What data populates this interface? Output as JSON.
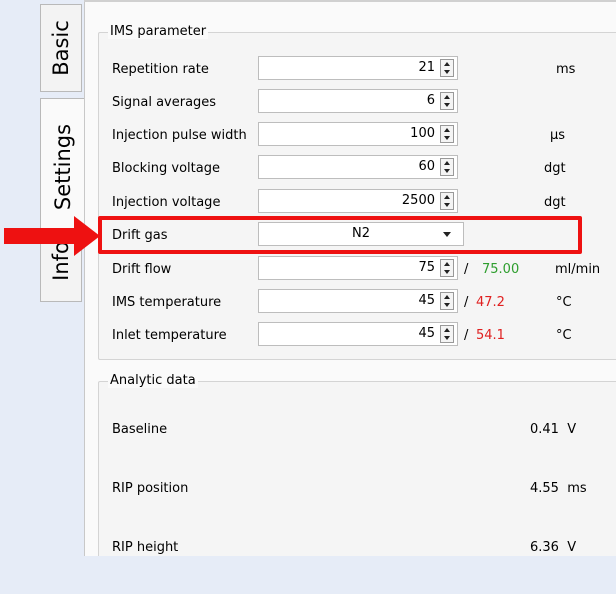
{
  "tabs": [
    {
      "label": "Basic"
    },
    {
      "label": "Settings"
    },
    {
      "label": "Info"
    }
  ],
  "ims": {
    "title": "IMS parameter",
    "rows": [
      {
        "label": "Repetition rate",
        "value": "21",
        "unit": "ms"
      },
      {
        "label": "Signal averages",
        "value": "6",
        "unit": ""
      },
      {
        "label": "Injection pulse width",
        "value": "100",
        "unit": "μs"
      },
      {
        "label": "Blocking voltage",
        "value": "60",
        "unit": "dgt"
      },
      {
        "label": "Injection voltage",
        "value": "2500",
        "unit": "dgt"
      },
      {
        "label": "Drift gas",
        "value": "N2",
        "unit": ""
      },
      {
        "label": "Drift flow",
        "value": "75",
        "separator": "/",
        "measured": "75.00",
        "unit": "ml/min"
      },
      {
        "label": "IMS temperature",
        "value": "45",
        "separator": "/",
        "measured": "47.2",
        "unit": "°C"
      },
      {
        "label": "Inlet temperature",
        "value": "45",
        "separator": "/",
        "measured": "54.1",
        "unit": "°C"
      }
    ]
  },
  "analytic": {
    "title": "Analytic data",
    "rows": [
      {
        "label": "Baseline",
        "value": "0.41  V"
      },
      {
        "label": "RIP position",
        "value": "4.55  ms"
      },
      {
        "label": "RIP height",
        "value": "6.36  V"
      }
    ]
  },
  "colors": {
    "ok": "#2e9e2e",
    "warn": "#e02020",
    "highlight": "#e11111"
  }
}
